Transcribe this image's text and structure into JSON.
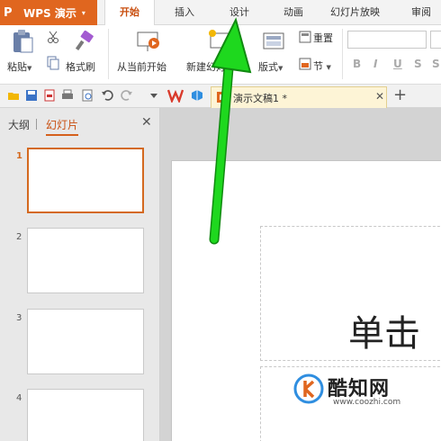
{
  "app": {
    "logo": "P",
    "name": "WPS 演示",
    "caret": "▾"
  },
  "menu": {
    "tabs": [
      {
        "label": "开始",
        "active": true
      },
      {
        "label": "插入"
      },
      {
        "label": "设计"
      },
      {
        "label": "动画"
      },
      {
        "label": "幻灯片放映"
      },
      {
        "label": "审阅"
      }
    ]
  },
  "ribbon": {
    "paste": "粘贴",
    "format_painter": "格式刷",
    "from_current": "从当前开始",
    "new_slide": "新建幻灯",
    "layout": "版式",
    "reset": "重置",
    "section": "节",
    "bold": "B",
    "italic": "I",
    "underline": "U",
    "strike": "S",
    "shadow": "S"
  },
  "doc_tab": {
    "title": "演示文稿1 *",
    "close": "✕",
    "new_tab": "+"
  },
  "panel": {
    "tab_outline": "大纲",
    "tab_slides": "幻灯片",
    "close": "✕",
    "slides": [
      "1",
      "2",
      "3",
      "4"
    ]
  },
  "slide": {
    "title_prefix": "单击"
  },
  "watermark": {
    "name": "酷知网",
    "url": "www.coozhi.com"
  },
  "colors": {
    "accent": "#e0661f",
    "arrow": "#1ed81e"
  }
}
